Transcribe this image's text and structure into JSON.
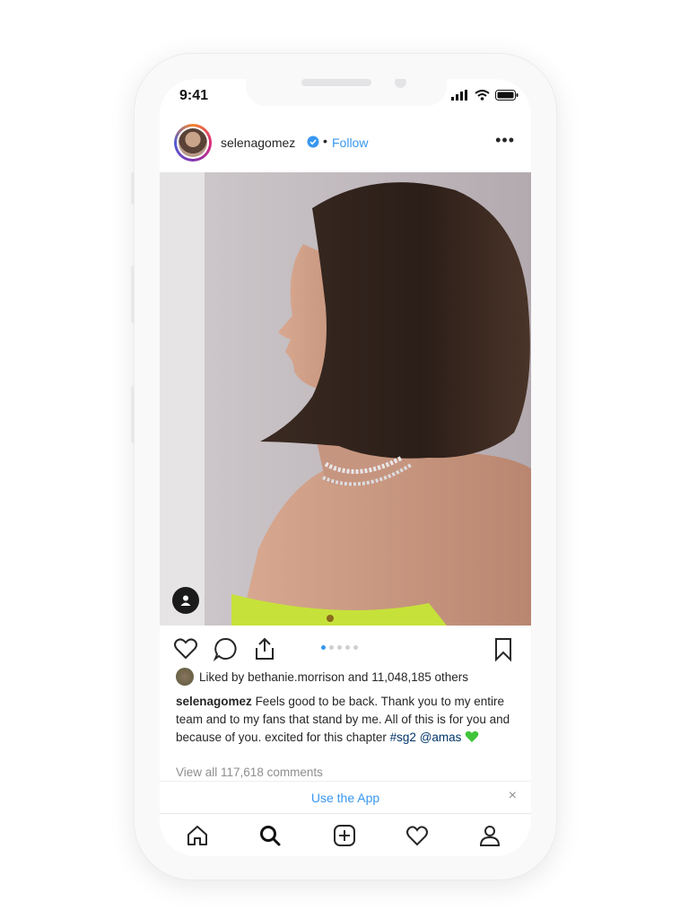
{
  "status_bar": {
    "time": "9:41"
  },
  "post": {
    "username": "selenagomez",
    "separator": "•",
    "follow_label": "Follow",
    "more_label": "•••",
    "carousel": {
      "total": 5,
      "active_index": 0
    }
  },
  "likes": {
    "prefix": "Liked by",
    "user": "bethanie.morrison",
    "middle": "and",
    "count": "11,048,185",
    "suffix": "others"
  },
  "caption": {
    "user": "selenagomez",
    "text": "Feels good to be back. Thank you to my entire team and to my fans that stand by me. All of this is for you and because of you. excited for this chapter",
    "hashtag": "#sg2",
    "mention": "@amas"
  },
  "view_comments": "View all 117,618 comments",
  "banner": {
    "label": "Use the App",
    "close": "×"
  },
  "colors": {
    "link": "#3897f0",
    "verified": "#3897f0",
    "emoji_heart": "#3fc43a",
    "text": "#262626",
    "muted": "#8e8e8e"
  },
  "tabbar": {
    "items": [
      {
        "name": "home-icon"
      },
      {
        "name": "search-icon"
      },
      {
        "name": "new-post-icon"
      },
      {
        "name": "activity-icon"
      },
      {
        "name": "profile-icon"
      }
    ]
  }
}
